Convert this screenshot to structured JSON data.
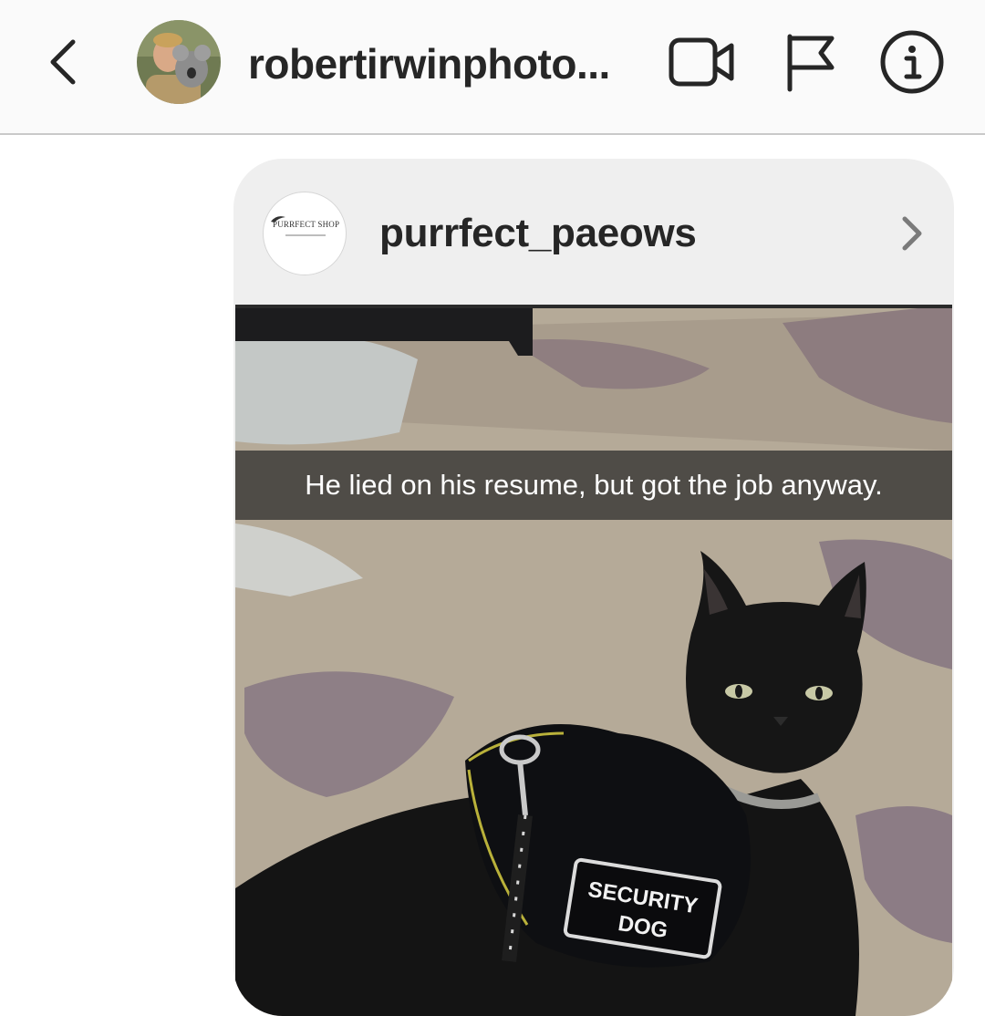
{
  "header": {
    "username": "robertirwinphoto...",
    "icons": {
      "back": "chevron-left-icon",
      "video": "video-camera-icon",
      "flag": "flag-icon",
      "info": "info-icon"
    }
  },
  "shared_post": {
    "author": "purrfect_paeows",
    "author_avatar_text": "PURRFECT SHOP",
    "caption": "He lied on his resume, but got the job anyway.",
    "patch_line1": "SECURITY",
    "patch_line2": "DOG"
  },
  "colors": {
    "header_bg": "#fafafa",
    "card_bg": "#efefef",
    "text": "#262626"
  }
}
